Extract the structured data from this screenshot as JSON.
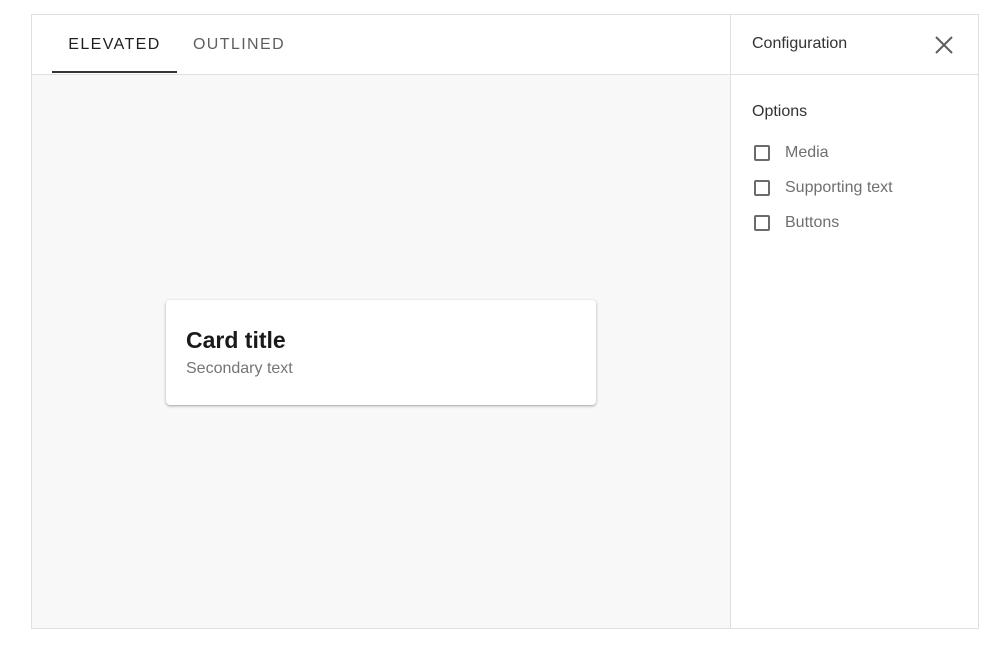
{
  "tabs": [
    {
      "label": "ELEVATED",
      "selected": true
    },
    {
      "label": "OUTLINED",
      "selected": false
    }
  ],
  "card": {
    "title": "Card title",
    "secondary": "Secondary text"
  },
  "config": {
    "title": "Configuration",
    "close_icon": "close-icon",
    "options_label": "Options",
    "options": [
      {
        "label": "Media",
        "checked": false
      },
      {
        "label": "Supporting text",
        "checked": false
      },
      {
        "label": "Buttons",
        "checked": false
      }
    ]
  }
}
